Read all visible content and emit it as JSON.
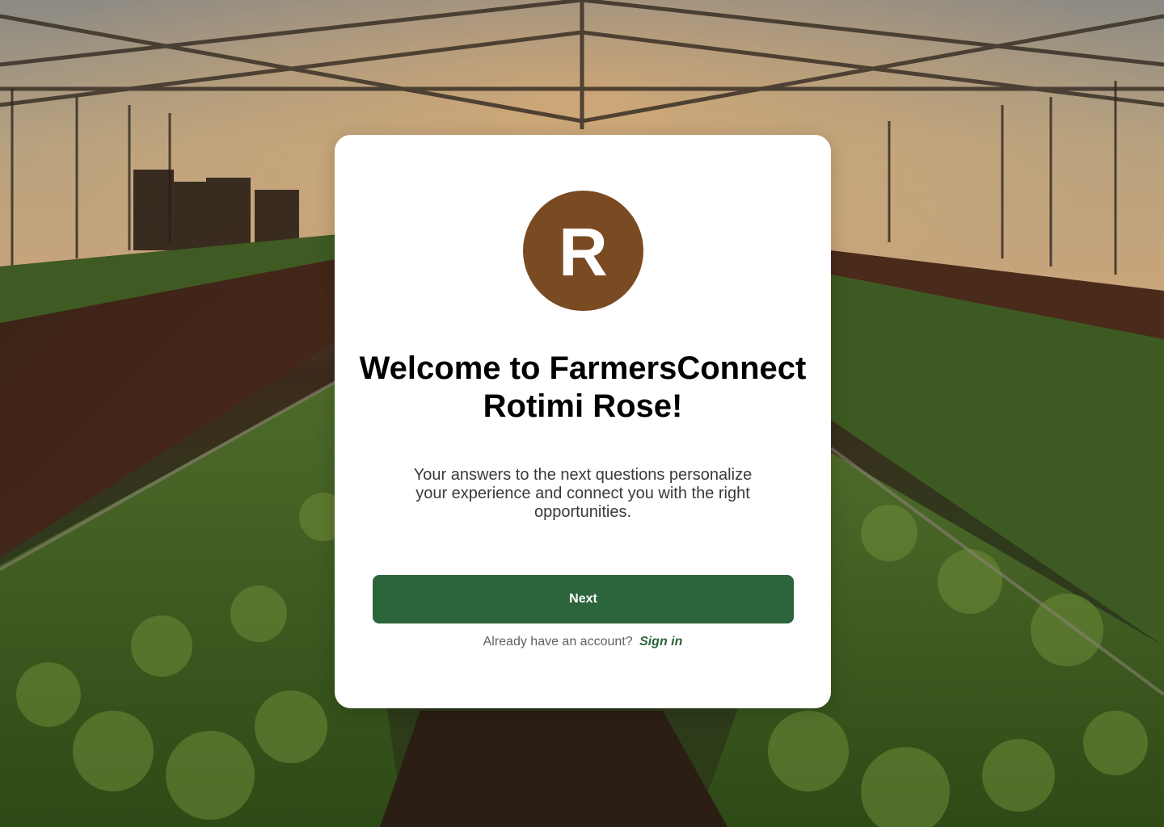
{
  "avatar": {
    "initial": "R",
    "color": "#7a4a22"
  },
  "welcome": {
    "line1": "Welcome to FarmersConnect",
    "line2": "Rotimi Rose!"
  },
  "subtitle": {
    "line1": "Your answers to the next questions personalize",
    "line2": "your experience and connect you with the right",
    "line3": "opportunities."
  },
  "actions": {
    "next_label": "Next",
    "next_color": "#2c643c",
    "signin_prompt": "Already have an account?",
    "signin_label": "Sign in"
  },
  "background": {
    "scene": "greenhouse-photo"
  }
}
